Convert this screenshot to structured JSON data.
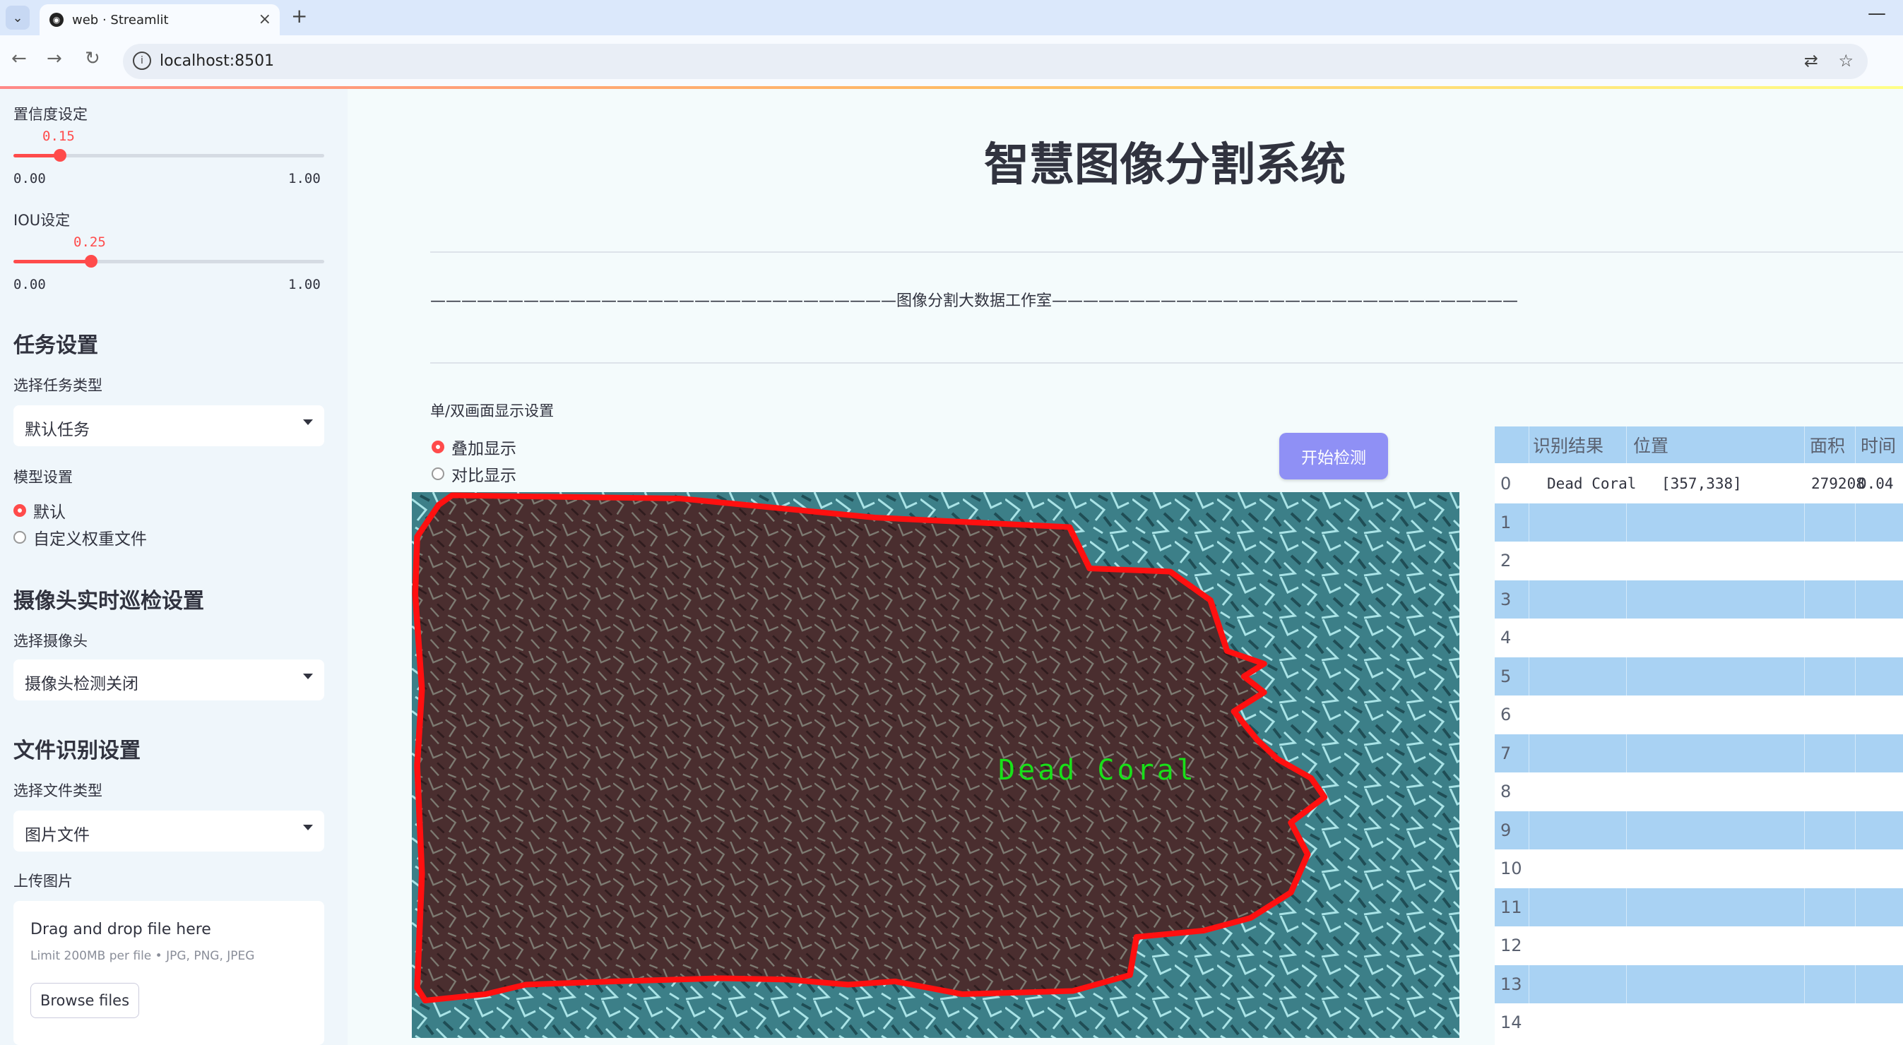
{
  "browser": {
    "tab_title": "web · Streamlit",
    "url": "localhost:8501"
  },
  "sidebar": {
    "confidence": {
      "label": "置信度设定",
      "value": "0.15",
      "min": "0.00",
      "max": "1.00",
      "fraction": 0.15
    },
    "iou": {
      "label": "IOU设定",
      "value": "0.25",
      "min": "0.00",
      "max": "1.00",
      "fraction": 0.25
    },
    "task_header": "任务设置",
    "task_type_label": "选择任务类型",
    "task_type_value": "默认任务",
    "model_label": "模型设置",
    "model_options": [
      "默认",
      "自定义权重文件"
    ],
    "model_selected": 0,
    "camera_header": "摄像头实时巡检设置",
    "camera_label": "选择摄像头",
    "camera_value": "摄像头检测关闭",
    "file_header": "文件识别设置",
    "file_type_label": "选择文件类型",
    "file_type_value": "图片文件",
    "upload_label": "上传图片",
    "upload_title": "Drag and drop file here",
    "upload_limit": "Limit 200MB per file • JPG, PNG, JPEG",
    "browse_label": "Browse files"
  },
  "main": {
    "title": "智慧图像分割系统",
    "studio_line": "——————————————————————————————图像分割大数据工作室——————————————————————————————",
    "display_label": "单/双画面显示设置",
    "display_options": [
      "叠加显示",
      "对比显示"
    ],
    "display_selected": 0,
    "detect_button": "开始检测",
    "detection_label": "Dead Coral"
  },
  "table": {
    "columns": [
      "",
      "识别结果",
      "位置",
      "面积",
      "时间"
    ],
    "rows": [
      [
        "0",
        "Dead Coral",
        "[357,338]",
        "279208",
        "0.04"
      ],
      [
        "1",
        "",
        "",
        "",
        ""
      ],
      [
        "2",
        "",
        "",
        "",
        ""
      ],
      [
        "3",
        "",
        "",
        "",
        ""
      ],
      [
        "4",
        "",
        "",
        "",
        ""
      ],
      [
        "5",
        "",
        "",
        "",
        ""
      ],
      [
        "6",
        "",
        "",
        "",
        ""
      ],
      [
        "7",
        "",
        "",
        "",
        ""
      ],
      [
        "8",
        "",
        "",
        "",
        ""
      ],
      [
        "9",
        "",
        "",
        "",
        ""
      ],
      [
        "10",
        "",
        "",
        "",
        ""
      ],
      [
        "11",
        "",
        "",
        "",
        ""
      ],
      [
        "12",
        "",
        "",
        "",
        ""
      ],
      [
        "13",
        "",
        "",
        "",
        ""
      ],
      [
        "14",
        "",
        "",
        "",
        ""
      ]
    ]
  },
  "colors": {
    "accent": "#ff4b4b",
    "button": "#8f90f5",
    "table_band": "#a9d2f3",
    "mask_outline": "#ff0000",
    "label_green": "#19e019"
  }
}
